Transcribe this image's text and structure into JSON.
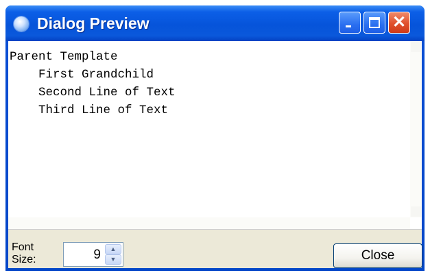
{
  "window": {
    "title": "Dialog Preview",
    "controls": {
      "minimize": "minimize-icon",
      "maximize": "maximize-icon",
      "close": "close-icon"
    }
  },
  "preview": {
    "lines": [
      "Parent Template",
      "    First Grandchild",
      "    Second Line of Text",
      "    Third Line of Text"
    ]
  },
  "footer": {
    "font_label_line1": "Font",
    "font_label_line2": "Size:",
    "font_size_value": "9",
    "close_label": "Close"
  },
  "colors": {
    "titlebar": "#0a58db",
    "window_frame": "#0347c8",
    "dialog_background": "#ece9d8",
    "close_button_red": "#e0502c"
  }
}
